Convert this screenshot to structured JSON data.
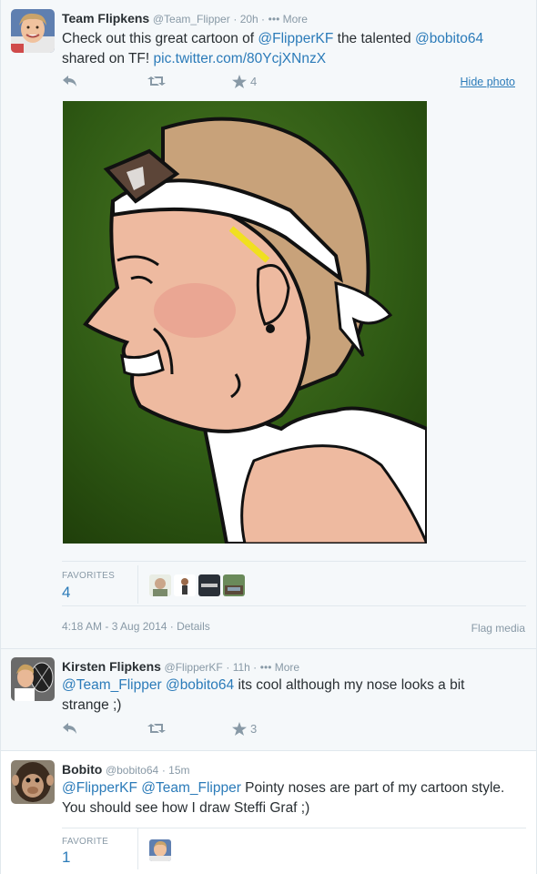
{
  "tweets": [
    {
      "name": "Team Flipkens",
      "handle": "@Team_Flipper",
      "time": "· 20h ·",
      "more": "••• More",
      "text_parts": [
        "Check out this great cartoon of ",
        "@FlipperKF",
        " the talented ",
        "@bobito64",
        " shared on TF! ",
        "pic.twitter.com/80YcjXNnzX"
      ],
      "actions": {
        "reply": "",
        "retweet": "",
        "favorite_count": "4"
      },
      "hide_photo": "Hide photo",
      "stats": {
        "label": "FAVORITES",
        "value": "4"
      },
      "timestamp": "4:18 AM - 3 Aug 2014 · Details",
      "flag_media": "Flag media"
    },
    {
      "name": "Kirsten Flipkens",
      "handle": "@FlipperKF",
      "time": "· 11h ·",
      "more": "••• More",
      "text_parts": [
        "@Team_Flipper",
        " ",
        "@bobito64",
        " its cool although my nose looks a bit strange ;)"
      ],
      "actions": {
        "reply": "",
        "retweet": "",
        "favorite_count": "3"
      }
    },
    {
      "name": "Bobito",
      "handle": "@bobito64",
      "time": "· 15m",
      "text_parts": [
        "@FlipperKF",
        " ",
        "@Team_Flipper",
        " Pointy noses are part of my cartoon style. You should see how I draw Steffi Graf  ;)"
      ],
      "stats": {
        "label": "FAVORITE",
        "value": "1"
      }
    }
  ],
  "icons": [
    "reply-icon",
    "retweet-icon",
    "favorite-star-icon"
  ],
  "colors": {
    "link": "#2b7bb9",
    "muted": "#8899a6",
    "bg_expanded": "#f5f8fa",
    "divider": "#e1e8ed"
  }
}
